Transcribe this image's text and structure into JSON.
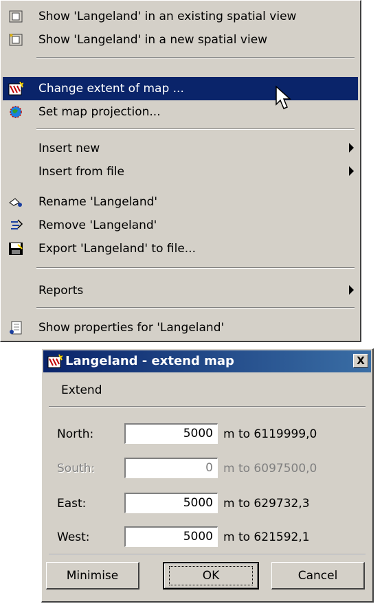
{
  "menu": {
    "items": [
      {
        "label": "Show 'Langeland' in an existing spatial view",
        "icon": "spatial-view-icon"
      },
      {
        "label": "Show 'Langeland' in a new spatial view",
        "icon": "new-spatial-view-icon"
      },
      {
        "label": "Change extent of map ...",
        "icon": "change-extent-icon",
        "highlighted": true
      },
      {
        "label": "Set map projection...",
        "icon": "globe-icon"
      },
      {
        "label": "Insert new",
        "submenu": true
      },
      {
        "label": "Insert from file",
        "submenu": true
      },
      {
        "label": "Rename 'Langeland'",
        "icon": "rename-icon"
      },
      {
        "label": "Remove 'Langeland'",
        "icon": "remove-icon"
      },
      {
        "label": "Export 'Langeland' to file...",
        "icon": "save-disk-icon"
      },
      {
        "label": "Reports",
        "submenu": true
      },
      {
        "label": "Show properties for 'Langeland'",
        "icon": "properties-icon"
      }
    ]
  },
  "dialog": {
    "title": "Langeland - extend map",
    "close_label": "X",
    "section_label": "Extend",
    "rows": [
      {
        "label": "North:",
        "value": "5000",
        "suffix": "m to 6119999,0",
        "disabled": false
      },
      {
        "label": "South:",
        "value": "0",
        "suffix": "m to 6097500,0",
        "disabled": true
      },
      {
        "label": "East:",
        "value": "5000",
        "suffix": "m to 629732,3",
        "disabled": false
      },
      {
        "label": "West:",
        "value": "5000",
        "suffix": "m to 621592,1",
        "disabled": false
      }
    ],
    "buttons": {
      "minimise": "Minimise",
      "ok": "OK",
      "cancel": "Cancel"
    }
  },
  "colors": {
    "highlight": "#0a246a",
    "face": "#d4d0c8",
    "title_gradient_end": "#3a6ea5"
  }
}
